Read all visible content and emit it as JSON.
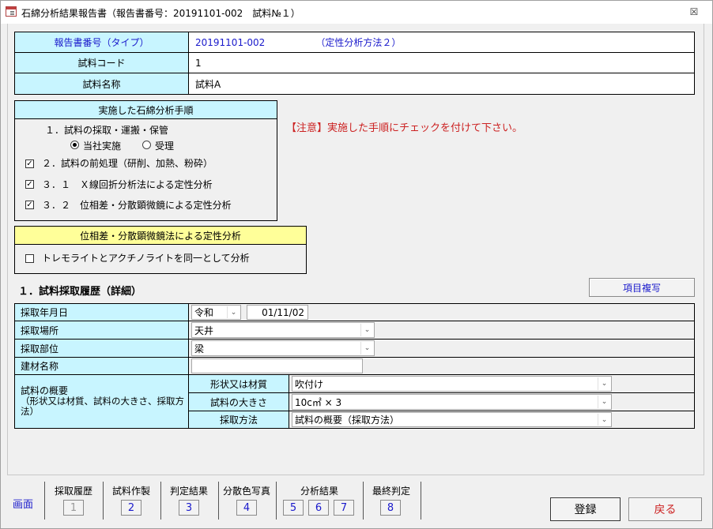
{
  "window": {
    "title": "石綿分析結果報告書（報告書番号：20191101-002　試料№１）",
    "close_glyph": "☒"
  },
  "header_table": {
    "report_number_label": "報告書番号（タイプ）",
    "report_number_value": "20191101-002",
    "analysis_type": "（定性分析方法２）",
    "sample_code_label": "試料コード",
    "sample_code_value": "1",
    "sample_name_label": "試料名称",
    "sample_name_value": "試料A"
  },
  "procedure": {
    "heading": "実施した石綿分析手順",
    "step1": "１．試料の採取・運搬・保管",
    "radio_self": "当社実施",
    "radio_received": "受理",
    "radio_selected": "当社実施",
    "step2": "２．試料の前処理（研削、加熱、粉砕）",
    "step2_checked": true,
    "step31": "３．１　Ｘ線回折分析法による定性分析",
    "step31_checked": true,
    "step32": "３．２　位相差・分散顕微鏡による定性分析",
    "step32_checked": true,
    "check_glyph": "✓"
  },
  "notice": "【注意】実施した手順にチェックを付けて下さい。",
  "microscopy": {
    "heading": "位相差・分散顕微鏡法による定性分析",
    "tremolite_label": "トレモライトとアクチノライトを同一として分析",
    "tremolite_checked": false
  },
  "history": {
    "section_title": "１．試料採取履歴（詳細）",
    "copy_button": "項目複写",
    "date_label": "採取年月日",
    "era_value": "令和",
    "date_value": "01/11/02",
    "place_label": "採取場所",
    "place_value": "天井",
    "part_label": "採取部位",
    "part_value": "梁",
    "material_label": "建材名称",
    "material_value": "",
    "summary_label": "試料の概要",
    "summary_note": "（形状又は材質、試料の大きさ、採取方法）",
    "shape_label": "形状又は材質",
    "shape_value": "吹付け",
    "size_label": "試料の大きさ",
    "size_value": "10c㎡ × 3",
    "method_label": "採取方法",
    "method_value": "試料の概要（採取方法）"
  },
  "navigation": {
    "screen_label": "画面",
    "tabs": [
      {
        "label": "採取履歴",
        "buttons": [
          "1"
        ],
        "enabled": false
      },
      {
        "label": "試料作製",
        "buttons": [
          "2"
        ],
        "enabled": true
      },
      {
        "label": "判定結果",
        "buttons": [
          "3"
        ],
        "enabled": true
      },
      {
        "label": "分散色写真",
        "buttons": [
          "4"
        ],
        "enabled": true
      },
      {
        "label": "分析結果",
        "buttons": [
          "5",
          "6",
          "7"
        ],
        "enabled": true
      },
      {
        "label": "最終判定",
        "buttons": [
          "8"
        ],
        "enabled": true
      }
    ],
    "register_button": "登録",
    "back_button": "戻る"
  },
  "colors": {
    "label_bg": "#c8f5ff",
    "yellow_bg": "#ffff99",
    "blue_text": "#1a1acc",
    "red_text": "#cc2222"
  },
  "icons": {
    "dropdown_arrow": "⌄"
  }
}
